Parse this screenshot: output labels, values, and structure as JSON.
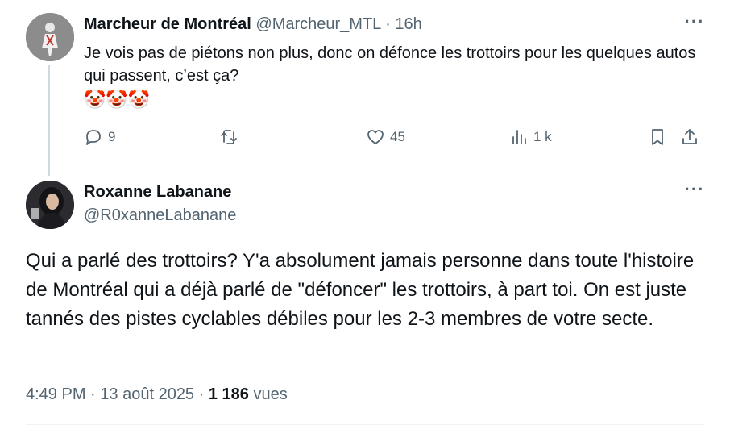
{
  "parent_tweet": {
    "author_name": "Marcheur de Montréal",
    "handle": "@Marcheur_MTL",
    "separator": "·",
    "time": "16h",
    "text": "Je vois pas de piétons non plus, donc on défonce les trottoirs pour les quelques autos qui passent, c’est ça?",
    "emoji": "🤡🤡🤡",
    "more_label": "···",
    "actions": {
      "reply_count": "9",
      "retweet_count": "",
      "like_count": "45",
      "views_count": "1 k"
    },
    "icons": {
      "reply": "reply-icon",
      "retweet": "retweet-icon",
      "like": "heart-icon",
      "views": "views-icon",
      "bookmark": "bookmark-icon",
      "share": "share-icon"
    }
  },
  "main_tweet": {
    "author_name": "Roxanne Labanane",
    "handle": "@R0xanneLabanane",
    "more_label": "···",
    "text": "Qui a parlé des trottoirs? Y'a absolument jamais personne dans toute l'histoire de Montréal qui a déjà parlé de \"défoncer\" les trottoirs, à part toi. On est juste tannés des pistes cyclables débiles pour les 2-3 membres de votre secte.",
    "time": "4:49 PM",
    "separator": "·",
    "date": "13 août 2025",
    "views_count": "1 186",
    "views_label": "vues"
  },
  "colors": {
    "text_primary": "#0f1419",
    "text_secondary": "#536471",
    "thread_line": "#cfd9de"
  }
}
